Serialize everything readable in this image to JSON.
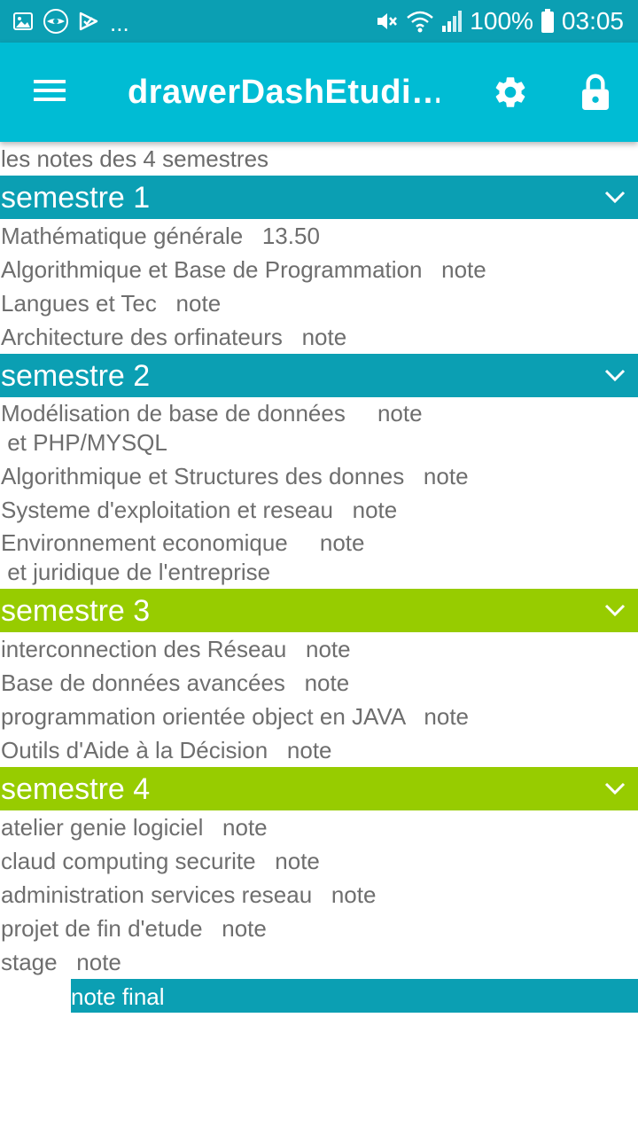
{
  "status_bar": {
    "left_icons": [
      "image-icon",
      "app-logo-icon",
      "checkmark-notification-icon"
    ],
    "more": "...",
    "battery": "100%",
    "time": "03:05",
    "right_icons": [
      "mute-icon",
      "wifi-icon",
      "signal-icon",
      "battery-icon"
    ]
  },
  "app_bar": {
    "title": "drawerDashEtudi…",
    "icons": [
      "menu-icon",
      "gear-icon",
      "lock-icon"
    ]
  },
  "intro": "les notes des 4 semestres",
  "semesters": [
    {
      "title": "semestre 1",
      "color": "#0b9fb3",
      "rows": [
        "Mathématique générale   13.50",
        "Algorithmique et Base de Programmation   note",
        "Langues et Tec   note",
        "Architecture des orfinateurs   note"
      ]
    },
    {
      "title": "semestre 2",
      "color": "#0b9fb3",
      "rows": [
        "Modélisation de base de données     note\n et PHP/MYSQL",
        "Algorithmique et Structures des donnes   note",
        "Systeme d'exploitation et reseau   note",
        "Environnement economique     note\n et juridique de l'entreprise"
      ]
    },
    {
      "title": "semestre 3",
      "color": "#97cc00",
      "rows": [
        "interconnection des Réseau   note",
        "Base de données avancées   note",
        "programmation orientée object en JAVA   note",
        "Outils d'Aide à la Décision   note"
      ]
    },
    {
      "title": "semestre 4",
      "color": "#97cc00",
      "rows": [
        "atelier genie logiciel   note",
        "claud computing securite   note",
        "administration services reseau   note",
        "projet de fin d'etude   note",
        "stage   note"
      ]
    }
  ],
  "final": "note final"
}
